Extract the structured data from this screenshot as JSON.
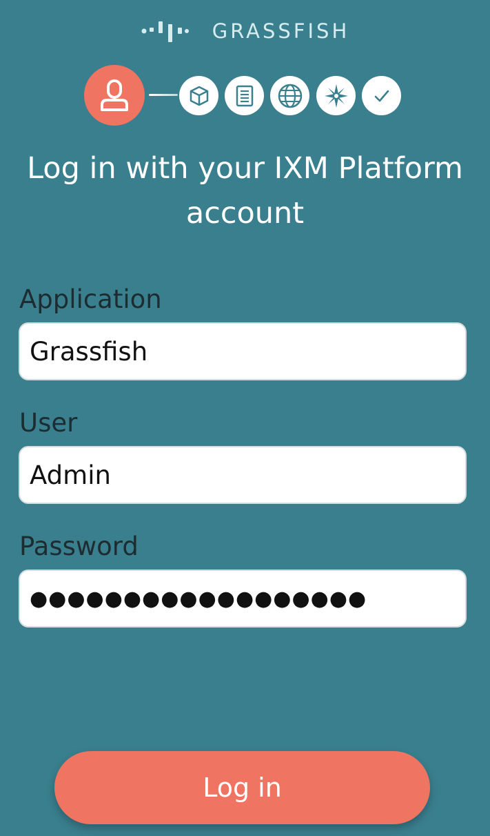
{
  "brand": {
    "name": "GRASSFISH",
    "logo_icon": "grassfish-bars-logo",
    "text_color": "#d6ecef"
  },
  "stepper": {
    "steps": [
      {
        "icon": "user-icon",
        "state": "active"
      },
      {
        "icon": "box-icon",
        "state": "pending"
      },
      {
        "icon": "document-icon",
        "state": "pending"
      },
      {
        "icon": "globe-icon",
        "state": "pending"
      },
      {
        "icon": "sparkle-icon",
        "state": "pending"
      },
      {
        "icon": "checkmark-icon",
        "state": "pending"
      }
    ]
  },
  "heading": "Log in with your IXM Platform account",
  "form": {
    "application": {
      "label": "Application",
      "value": "Grassfish"
    },
    "user": {
      "label": "User",
      "value": "Admin"
    },
    "password": {
      "label": "Password",
      "value": "●●●●●●●●●●●●●●●●●●"
    }
  },
  "login_button": "Log in",
  "colors": {
    "background": "#3a7f8e",
    "accent": "#ef7461",
    "label_text": "#1d2c30",
    "icon_teal": "#3a7f8e"
  }
}
